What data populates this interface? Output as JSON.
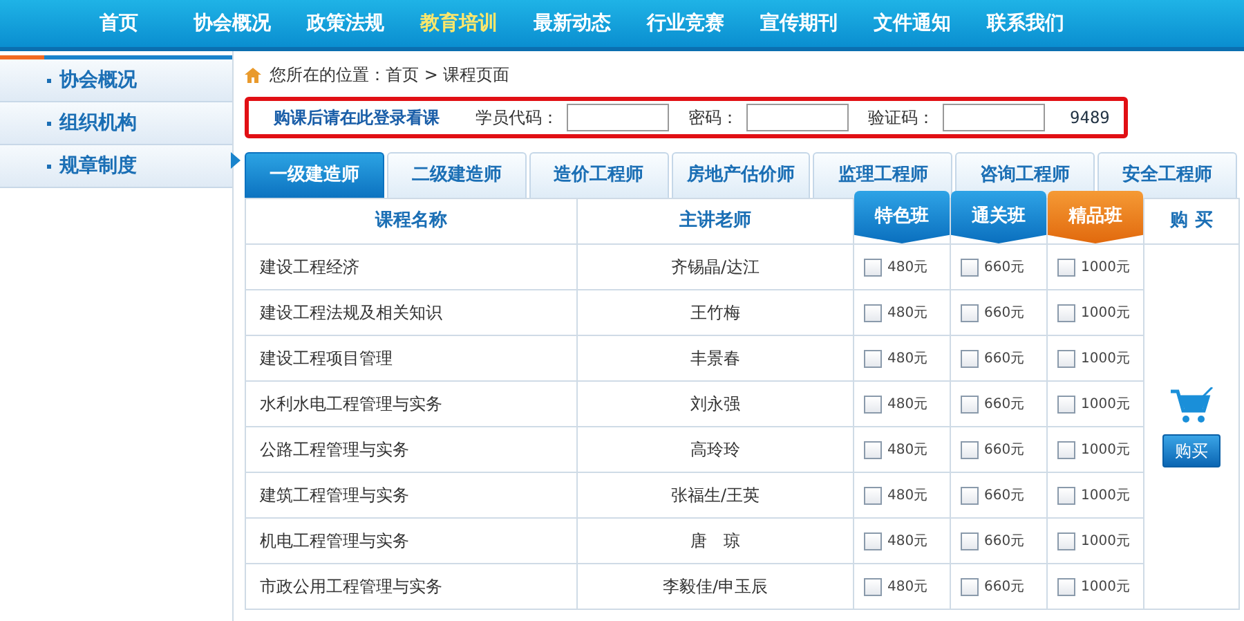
{
  "nav": [
    {
      "label": "首页",
      "selected": false
    },
    {
      "label": "协会概况",
      "selected": false
    },
    {
      "label": "政策法规",
      "selected": false
    },
    {
      "label": "教育培训",
      "selected": true
    },
    {
      "label": "最新动态",
      "selected": false
    },
    {
      "label": "行业竞赛",
      "selected": false
    },
    {
      "label": "宣传期刊",
      "selected": false
    },
    {
      "label": "文件通知",
      "selected": false
    },
    {
      "label": "联系我们",
      "selected": false
    }
  ],
  "sidebar": {
    "items": [
      {
        "label": "协会概况"
      },
      {
        "label": "组织机构"
      },
      {
        "label": "规章制度"
      }
    ]
  },
  "breadcrumb": "您所在的位置：首页 > 课程页面",
  "login": {
    "prompt": "购课后请在此登录看课",
    "fields": [
      {
        "label": "学员代码："
      },
      {
        "label": "密码："
      },
      {
        "label": "验证码："
      }
    ],
    "captcha": "9489"
  },
  "tabs": [
    {
      "label": "一级建造师",
      "selected": true
    },
    {
      "label": "二级建造师",
      "selected": false
    },
    {
      "label": "造价工程师",
      "selected": false
    },
    {
      "label": "房地产估价师",
      "selected": false
    },
    {
      "label": "监理工程师",
      "selected": false
    },
    {
      "label": "咨询工程师",
      "selected": false
    },
    {
      "label": "安全工程师",
      "selected": false
    }
  ],
  "table": {
    "columns": [
      {
        "label": "课程名称",
        "kind": "plain"
      },
      {
        "label": "主讲老师",
        "kind": "plain"
      },
      {
        "label": "特色班",
        "kind": "blue"
      },
      {
        "label": "通关班",
        "kind": "blue"
      },
      {
        "label": "精品班",
        "kind": "orange"
      },
      {
        "label": "购 买",
        "kind": "plain"
      }
    ],
    "rows": [
      {
        "course": "建设工程经济",
        "teacher": "齐锡晶/达江",
        "options": [
          {
            "price": "480元",
            "checked": false
          },
          {
            "price": "660元",
            "checked": false
          },
          {
            "price": "1000元",
            "checked": false
          }
        ]
      },
      {
        "course": "建设工程法规及相关知识",
        "teacher": "王竹梅",
        "options": [
          {
            "price": "480元",
            "checked": false
          },
          {
            "price": "660元",
            "checked": false
          },
          {
            "price": "1000元",
            "checked": false
          }
        ]
      },
      {
        "course": "建设工程项目管理",
        "teacher": "丰景春",
        "options": [
          {
            "price": "480元",
            "checked": false
          },
          {
            "price": "660元",
            "checked": false
          },
          {
            "price": "1000元",
            "checked": false
          }
        ]
      },
      {
        "course": "水利水电工程管理与实务",
        "teacher": "刘永强",
        "options": [
          {
            "price": "480元",
            "checked": false
          },
          {
            "price": "660元",
            "checked": false
          },
          {
            "price": "1000元",
            "checked": false
          }
        ]
      },
      {
        "course": "公路工程管理与实务",
        "teacher": "高玲玲",
        "options": [
          {
            "price": "480元",
            "checked": false
          },
          {
            "price": "660元",
            "checked": false
          },
          {
            "price": "1000元",
            "checked": false
          }
        ]
      },
      {
        "course": "建筑工程管理与实务",
        "teacher": "张福生/王英",
        "options": [
          {
            "price": "480元",
            "checked": false
          },
          {
            "price": "660元",
            "checked": false
          },
          {
            "price": "1000元",
            "checked": false
          }
        ]
      },
      {
        "course": "机电工程管理与实务",
        "teacher": "唐　琼",
        "options": [
          {
            "price": "480元",
            "checked": false
          },
          {
            "price": "660元",
            "checked": false
          },
          {
            "price": "1000元",
            "checked": false
          }
        ]
      },
      {
        "course": "市政公用工程管理与实务",
        "teacher": "李毅佳/申玉辰",
        "options": [
          {
            "price": "480元",
            "checked": false
          },
          {
            "price": "660元",
            "checked": false
          },
          {
            "price": "1000元",
            "checked": false
          }
        ]
      }
    ],
    "buy_button": "购买"
  }
}
